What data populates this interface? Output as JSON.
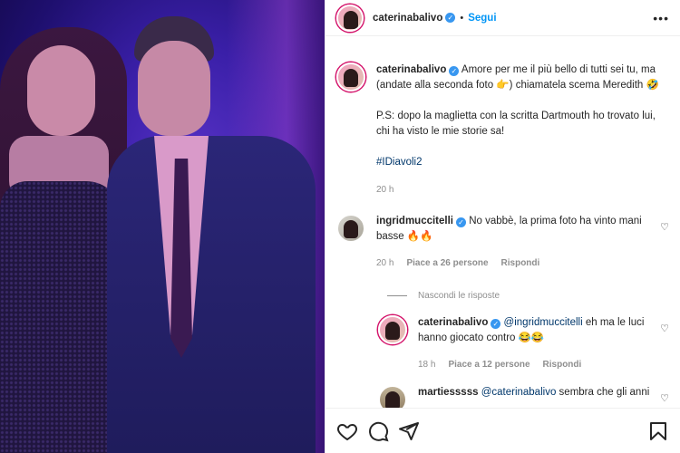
{
  "header": {
    "username": "caterinabalivo",
    "follow_label": "Segui"
  },
  "caption": {
    "username": "caterinabalivo",
    "text1": "Amore per me il più bello di tutti sei tu, ma (andate alla seconda foto 👉) chiamatela scema Meredith 🤣",
    "text2": "P.S: dopo la maglietta con la scritta Dartmouth ho trovato lui, chi ha visto le mie storie sa!",
    "hashtag": "#IDiavoli2",
    "time": "20 h"
  },
  "comment1": {
    "username": "ingridmuccitelli",
    "text": "No vabbè, la prima foto ha vinto mani basse 🔥🔥",
    "time": "20 h",
    "likes": "Piace a 26 persone",
    "reply": "Rispondi"
  },
  "hide_replies_label": "Nascondi le risposte",
  "reply1": {
    "username": "caterinabalivo",
    "mention": "@ingridmuccitelli",
    "text": "eh ma le luci hanno giocato contro 😂😂",
    "time": "18 h",
    "likes": "Piace a 12 persone",
    "reply": "Rispondi"
  },
  "comment2": {
    "username": "martiesssss",
    "mention": "@caterinabalivo",
    "text": "sembra che gli anni"
  },
  "icons": {
    "like": "heart-icon",
    "comment": "comment-icon",
    "share": "share-icon",
    "save": "bookmark-icon",
    "more": "more-icon",
    "verified": "verified-badge-icon"
  },
  "colors": {
    "accent": "#0095f6",
    "verified": "#3897f0",
    "muted": "#8e8e8e",
    "hashtag": "#00376b"
  }
}
